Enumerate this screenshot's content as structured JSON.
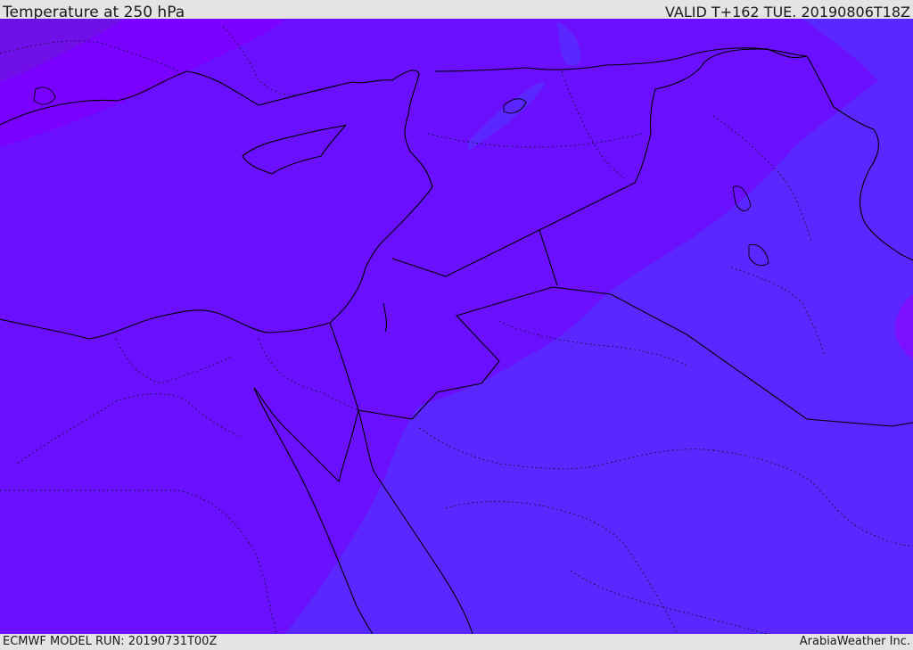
{
  "header": {
    "title": "Temperature at 250 hPa",
    "valid_time": "VALID T+162 TUE. 20190806T18Z"
  },
  "footer": {
    "model_run": "ECMWF MODEL RUN: 20190731T00Z",
    "credit": "ArabiaWeather Inc."
  },
  "map": {
    "field": "temperature_250hPa",
    "colors": {
      "coldest": "#7208ee",
      "cold": "#7a00ff",
      "mid": "#6a10ff",
      "warm": "#5a28ff",
      "warm_patch": "#5438f6",
      "border": "#000000",
      "region_border": "#101050"
    }
  }
}
